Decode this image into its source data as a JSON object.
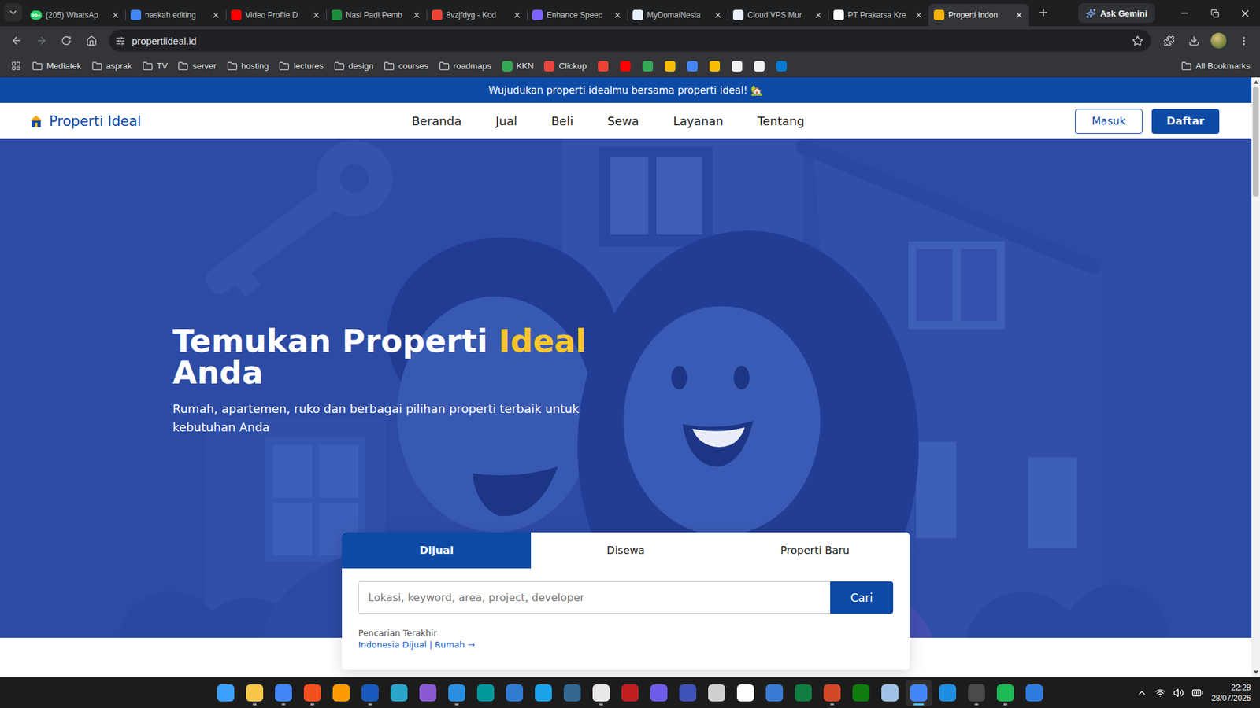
{
  "browser": {
    "tabs": [
      {
        "label": "(205) WhatsAp",
        "selected": false,
        "color": "#25d366",
        "badge": "99+"
      },
      {
        "label": "naskah editing",
        "selected": false,
        "color": "#4285f4"
      },
      {
        "label": "Video Profile D",
        "selected": false,
        "color": "#ff0000"
      },
      {
        "label": "Nasi Padi Pemb",
        "selected": false,
        "color": "#1e8e3e"
      },
      {
        "label": "8vzjfdyg - Kod",
        "selected": false,
        "color": "#ea4335"
      },
      {
        "label": "Enhance Speec",
        "selected": false,
        "color": "#7b61ff"
      },
      {
        "label": "MyDomaiNesia",
        "selected": false,
        "color": "#e8f0fe"
      },
      {
        "label": "Cloud VPS Mur",
        "selected": false,
        "color": "#e8f0fe"
      },
      {
        "label": "PT Prakarsa Kre",
        "selected": false,
        "color": "#ffffff"
      },
      {
        "label": "Properti Indon",
        "selected": true,
        "color": "#f4b400"
      }
    ],
    "gemini": "Ask Gemini",
    "address": "propertiideal.id",
    "bookmarks": [
      {
        "label": "Mediatek",
        "kind": "folder",
        "color": "#c7c7c7"
      },
      {
        "label": "asprak",
        "kind": "folder",
        "color": "#c7c7c7"
      },
      {
        "label": "TV",
        "kind": "folder",
        "color": "#c7c7c7"
      },
      {
        "label": "server",
        "kind": "folder",
        "color": "#c7c7c7"
      },
      {
        "label": "hosting",
        "kind": "folder",
        "color": "#c7c7c7"
      },
      {
        "label": "lectures",
        "kind": "folder",
        "color": "#c7c7c7"
      },
      {
        "label": "design",
        "kind": "folder",
        "color": "#c7c7c7"
      },
      {
        "label": "courses",
        "kind": "folder",
        "color": "#c7c7c7"
      },
      {
        "label": "roadmaps",
        "kind": "folder",
        "color": "#c7c7c7"
      },
      {
        "label": "KKN",
        "kind": "link",
        "color": "#34a853"
      },
      {
        "label": "Clickup",
        "kind": "link",
        "color": "#e8453c"
      }
    ],
    "bookmark_icons": [
      {
        "color": "#ea4335"
      },
      {
        "color": "#ff0000"
      },
      {
        "color": "#34a853"
      },
      {
        "color": "#fbbc04"
      },
      {
        "color": "#4285f4"
      },
      {
        "color": "#fbbc04"
      },
      {
        "color": "#f1f1f1"
      },
      {
        "color": "#f1f1f1"
      },
      {
        "color": "#0078d4"
      }
    ],
    "all_bookmarks": "All Bookmarks"
  },
  "site": {
    "announcement": "Wujudukan properti idealmu bersama properti ideal! 🏡",
    "logo": "Properti Ideal",
    "nav": [
      {
        "label": "Beranda",
        "selected": false
      },
      {
        "label": "Jual",
        "selected": false
      },
      {
        "label": "Beli",
        "selected": false
      },
      {
        "label": "Sewa",
        "selected": false
      },
      {
        "label": "Layanan",
        "selected": false
      },
      {
        "label": "Tentang",
        "selected": false
      }
    ],
    "auth": {
      "login": "Masuk",
      "register": "Daftar"
    },
    "hero": {
      "title_lines": [
        [
          {
            "text": "Temukan Properti",
            "highlight": false
          },
          {
            "text": "Ideal",
            "highlight": true
          }
        ],
        [
          {
            "text": "Anda",
            "highlight": false
          }
        ]
      ],
      "subtitle": "Rumah, apartemen, ruko dan berbagai pilihan properti terbaik untuk kebutuhan Anda"
    },
    "search": {
      "tabs": [
        {
          "label": "Dijual",
          "selected": true
        },
        {
          "label": "Disewa",
          "selected": false
        },
        {
          "label": "Properti Baru",
          "selected": false
        }
      ],
      "placeholder": "Lokasi, keyword, area, project, developer",
      "button": "Cari",
      "recent_label": "Pencarian Terakhir",
      "recent": "Indonesia Dijual | Rumah →"
    }
  },
  "scrollbar": {
    "level": 0.19
  },
  "taskbar": {
    "apps": [
      {
        "color": "#3aa0ff",
        "running": false,
        "active": false
      },
      {
        "color": "#f8c648",
        "running": true,
        "active": false
      },
      {
        "color": "#4285f4",
        "running": true,
        "active": false
      },
      {
        "color": "#f24e1e",
        "running": true,
        "active": false
      },
      {
        "color": "#ff9a00",
        "running": false,
        "active": false
      },
      {
        "color": "#185abd",
        "running": true,
        "active": false
      },
      {
        "color": "#2aa6c9",
        "running": false,
        "active": false
      },
      {
        "color": "#8a5ad3",
        "running": false,
        "active": false
      },
      {
        "color": "#2a8fe0",
        "running": true,
        "active": false
      },
      {
        "color": "#00979c",
        "running": false,
        "active": false
      },
      {
        "color": "#2f7bd3",
        "running": false,
        "active": false
      },
      {
        "color": "#1aa3e8",
        "running": false,
        "active": false
      },
      {
        "color": "#336791",
        "running": false,
        "active": false
      },
      {
        "color": "#e8e8e8",
        "running": true,
        "active": false
      },
      {
        "color": "#c02020",
        "running": false,
        "active": false
      },
      {
        "color": "#6c5ce7",
        "running": false,
        "active": false
      },
      {
        "color": "#3f51b5",
        "running": false,
        "active": false
      },
      {
        "color": "#cfcfcf",
        "running": false,
        "active": false
      },
      {
        "color": "#ffffff",
        "running": false,
        "active": false
      },
      {
        "color": "#3a7bd5",
        "running": false,
        "active": false
      },
      {
        "color": "#107c41",
        "running": false,
        "active": false
      },
      {
        "color": "#d24726",
        "running": true,
        "active": false
      },
      {
        "color": "#107c10",
        "running": false,
        "active": false
      },
      {
        "color": "#9fc3e6",
        "running": false,
        "active": false
      },
      {
        "color": "#4285f4",
        "running": true,
        "active": true
      },
      {
        "color": "#1f8de0",
        "running": false,
        "active": false
      },
      {
        "color": "#4a4a4a",
        "running": true,
        "active": false
      },
      {
        "color": "#1db954",
        "running": true,
        "active": false
      },
      {
        "color": "#2d7de0",
        "running": false,
        "active": false
      }
    ],
    "clock": {
      "time": "22:28",
      "date": "28/07/2026"
    }
  }
}
